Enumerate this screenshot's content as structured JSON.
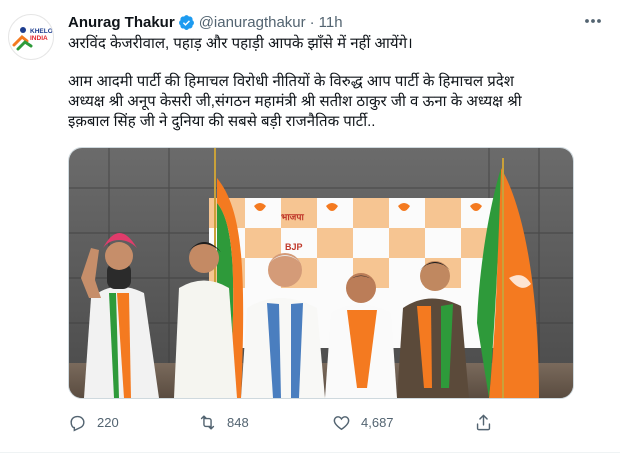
{
  "tweet": {
    "author_name": "Anurag Thakur",
    "handle": "@ianuragthakur",
    "separator": "·",
    "time": "11h",
    "line1": "अरविंद केजरीवाल, पहाड़ और पहाड़ी आपके झाँसे में नहीं आयेंगे।",
    "body_lines": [
      "आम आदमी पार्टी की हिमाचल विरोधी नीतियों के विरुद्ध आप पार्टी के हिमाचल प्रदेश",
      "अध्यक्ष श्री अनूप केसरी जी,संगठन महामंत्री श्री सतीश ठाकुर जी व ऊना के अध्यक्ष श्री",
      "इक़बाल सिंह जी ने दुनिया की सबसे बड़ी राजनैतिक पार्टी.."
    ]
  },
  "avatar_logo": {
    "line1": "KHELO",
    "line2": "INDIA"
  },
  "media": {
    "backdrop_labels": [
      "भाजपा",
      "BJP"
    ]
  },
  "actions": {
    "reply_count": "220",
    "retweet_count": "848",
    "like_count": "4,687"
  },
  "colors": {
    "verified": "#1d9bf0",
    "text_secondary": "#536471",
    "saffron": "#f47a20",
    "green": "#2e9a3a"
  }
}
